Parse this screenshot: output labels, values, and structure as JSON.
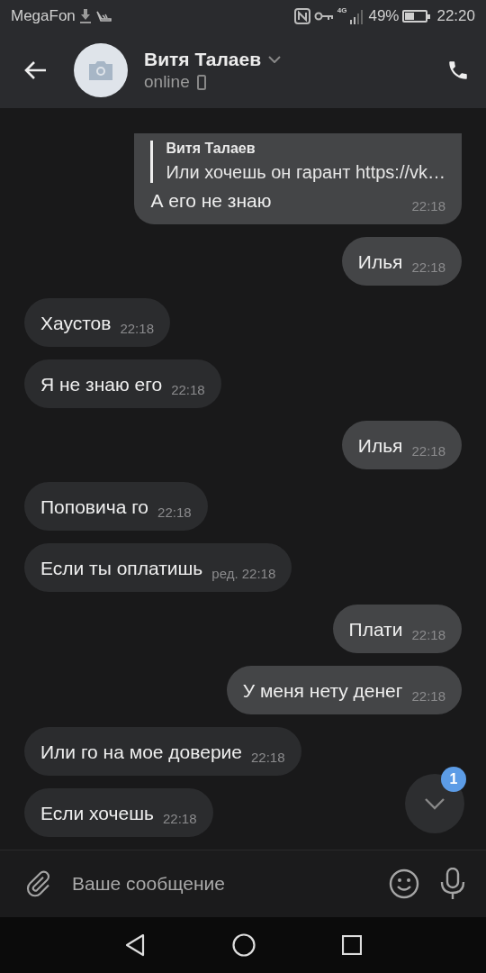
{
  "status_bar": {
    "carrier": "MegaFon",
    "battery_percent": "49%",
    "network": "4G",
    "time": "22:20"
  },
  "header": {
    "name": "Витя Талаев",
    "status": "online"
  },
  "messages": [
    {
      "kind": "outgoing",
      "reply": {
        "author": "Витя Талаев",
        "text": "Или хочешь он гарант https://vk…"
      },
      "text": "А его не знаю",
      "time": "22:18"
    },
    {
      "kind": "outgoing",
      "text": "Илья",
      "time": "22:18"
    },
    {
      "kind": "incoming",
      "text": "Хаустов",
      "time": "22:18"
    },
    {
      "kind": "incoming",
      "text": "Я не знаю его",
      "time": "22:18"
    },
    {
      "kind": "outgoing",
      "text": "Илья",
      "time": "22:18"
    },
    {
      "kind": "incoming",
      "text": "Поповича го",
      "time": "22:18"
    },
    {
      "kind": "incoming",
      "text": "Если ты оплатишь",
      "edited": "ред.",
      "time": "22:18"
    },
    {
      "kind": "outgoing",
      "text": "Плати",
      "time": "22:18"
    },
    {
      "kind": "outgoing",
      "text": "У меня нету денег",
      "time": "22:18"
    },
    {
      "kind": "incoming",
      "text": "Или го на мое доверие",
      "time": "22:18"
    },
    {
      "kind": "incoming",
      "text": "Если хочешь",
      "time": "22:18"
    }
  ],
  "scroll_button": {
    "badge": "1"
  },
  "composer": {
    "placeholder": "Ваше сообщение"
  }
}
